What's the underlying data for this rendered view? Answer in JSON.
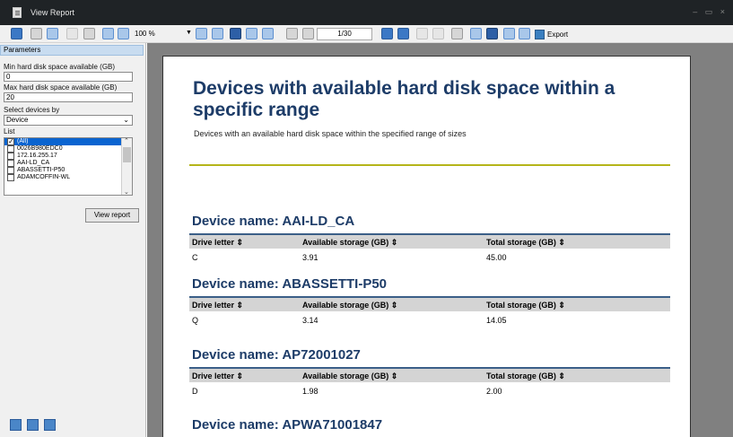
{
  "window": {
    "title": "View Report",
    "controls": "– ▭ ×"
  },
  "toolbar": {
    "zoom": "100 %",
    "page_indicator": "1/30",
    "export_label": "Export"
  },
  "params": {
    "header": "Parameters",
    "min_label": "Min hard disk space available (GB)",
    "min_value": "0",
    "max_label": "Max hard disk space available (GB)",
    "max_value": "20",
    "select_label": "Select devices by",
    "select_value": "Device",
    "list_label": "List",
    "list_items": [
      {
        "label": "(All)",
        "checked": true,
        "selected": true
      },
      {
        "label": "0026B980EDC0",
        "checked": false,
        "selected": false
      },
      {
        "label": "172.16.255.17",
        "checked": false,
        "selected": false
      },
      {
        "label": "AAI-LD_CA",
        "checked": false,
        "selected": false
      },
      {
        "label": "ABASSETTI-P50",
        "checked": false,
        "selected": false
      },
      {
        "label": "ADAMCOFFIN-WL",
        "checked": false,
        "selected": false
      }
    ],
    "view_report_label": "View report"
  },
  "report": {
    "title": "Devices with available hard disk space within a specific range",
    "subtitle": "Devices with an available hard disk space within the specified range of sizes",
    "columns": [
      "Drive letter ⇕",
      "Available storage (GB) ⇕",
      "Total storage (GB) ⇕"
    ],
    "devices": [
      {
        "heading": "Device name: AAI-LD_CA",
        "rows": [
          [
            "C",
            "3.91",
            "45.00"
          ]
        ]
      },
      {
        "heading": "Device name: ABASSETTI-P50",
        "rows": [
          [
            "Q",
            "3.14",
            "14.05"
          ]
        ]
      },
      {
        "heading": "Device name: AP72001027",
        "rows": [
          [
            "D",
            "1.98",
            "2.00"
          ]
        ]
      },
      {
        "heading": "Device name: APWA71001847",
        "rows": []
      }
    ]
  }
}
